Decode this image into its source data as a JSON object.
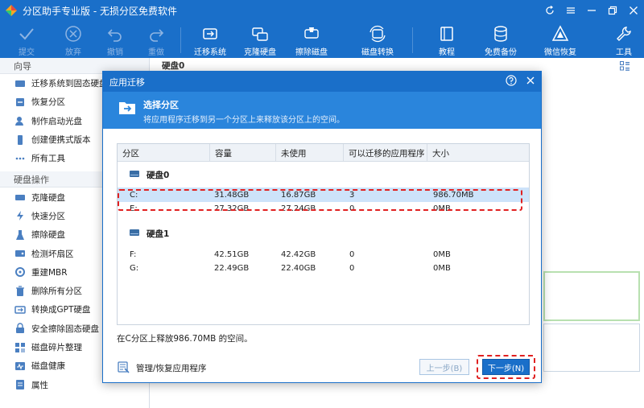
{
  "window": {
    "title": "分区助手专业版 - 无损分区免费软件"
  },
  "toolbar": {
    "submit": "提交",
    "discard": "放弃",
    "undo": "撤销",
    "redo": "重做",
    "migrate_os": "迁移系统",
    "clone_disk": "克隆硬盘",
    "wipe_disk": "擦除磁盘",
    "disk_convert": "磁盘转换",
    "tutorial": "教程",
    "free_backup": "免费备份",
    "wechat_restore": "微信恢复",
    "tools": "工具"
  },
  "sidebar": {
    "wizard_header": "向导",
    "wizard_items": [
      {
        "label": "迁移系统到固态硬盘",
        "icon": "migrate-icon"
      },
      {
        "label": "恢复分区",
        "icon": "recover-icon"
      },
      {
        "label": "制作启动光盘",
        "icon": "boot-disc-icon"
      },
      {
        "label": "创建便携式版本",
        "icon": "portable-icon"
      },
      {
        "label": "所有工具",
        "icon": "more-icon"
      }
    ],
    "disk_header": "硬盘操作",
    "disk_items": [
      {
        "label": "克隆硬盘",
        "icon": "clone-icon"
      },
      {
        "label": "快速分区",
        "icon": "quick-partition-icon"
      },
      {
        "label": "擦除硬盘",
        "icon": "wipe-icon"
      },
      {
        "label": "检测坏扇区",
        "icon": "scan-icon"
      },
      {
        "label": "重建MBR",
        "icon": "rebuild-mbr-icon"
      },
      {
        "label": "删除所有分区",
        "icon": "delete-all-icon"
      },
      {
        "label": "转换成GPT硬盘",
        "icon": "gpt-icon"
      },
      {
        "label": "安全擦除固态硬盘",
        "icon": "secure-erase-icon"
      },
      {
        "label": "磁盘碎片整理",
        "icon": "defrag-icon"
      },
      {
        "label": "磁盘健康",
        "icon": "health-icon"
      },
      {
        "label": "属性",
        "icon": "properties-icon"
      }
    ]
  },
  "main": {
    "disk_label": "硬盘0"
  },
  "dialog": {
    "title": "应用迁移",
    "heading": "选择分区",
    "subheading": "将应用程序迁移到另一个分区上来释放该分区上的空间。",
    "columns": [
      "分区",
      "容量",
      "未使用",
      "可以迁移的应用程序",
      "大小"
    ],
    "groups": [
      {
        "name": "硬盘0",
        "rows": [
          {
            "partition": "C:",
            "capacity": "31.48GB",
            "unused": "16.87GB",
            "apps": "3",
            "size": "986.70MB",
            "selected": true
          },
          {
            "partition": "E:",
            "capacity": "27.32GB",
            "unused": "27.24GB",
            "apps": "0",
            "size": "0MB",
            "selected": false
          }
        ]
      },
      {
        "name": "硬盘1",
        "rows": [
          {
            "partition": "F:",
            "capacity": "42.51GB",
            "unused": "42.42GB",
            "apps": "0",
            "size": "0MB",
            "selected": false
          },
          {
            "partition": "G:",
            "capacity": "22.49GB",
            "unused": "22.40GB",
            "apps": "0",
            "size": "0MB",
            "selected": false
          }
        ]
      }
    ],
    "status": "在C分区上释放986.70MB 的空间。",
    "manage_link": "管理/恢复应用程序",
    "prev_button": "上一步(B)",
    "next_button": "下一步(N)"
  },
  "colors": {
    "accent": "#1a6fc9",
    "highlight": "#e02020",
    "selected_row": "#cde3fa"
  }
}
